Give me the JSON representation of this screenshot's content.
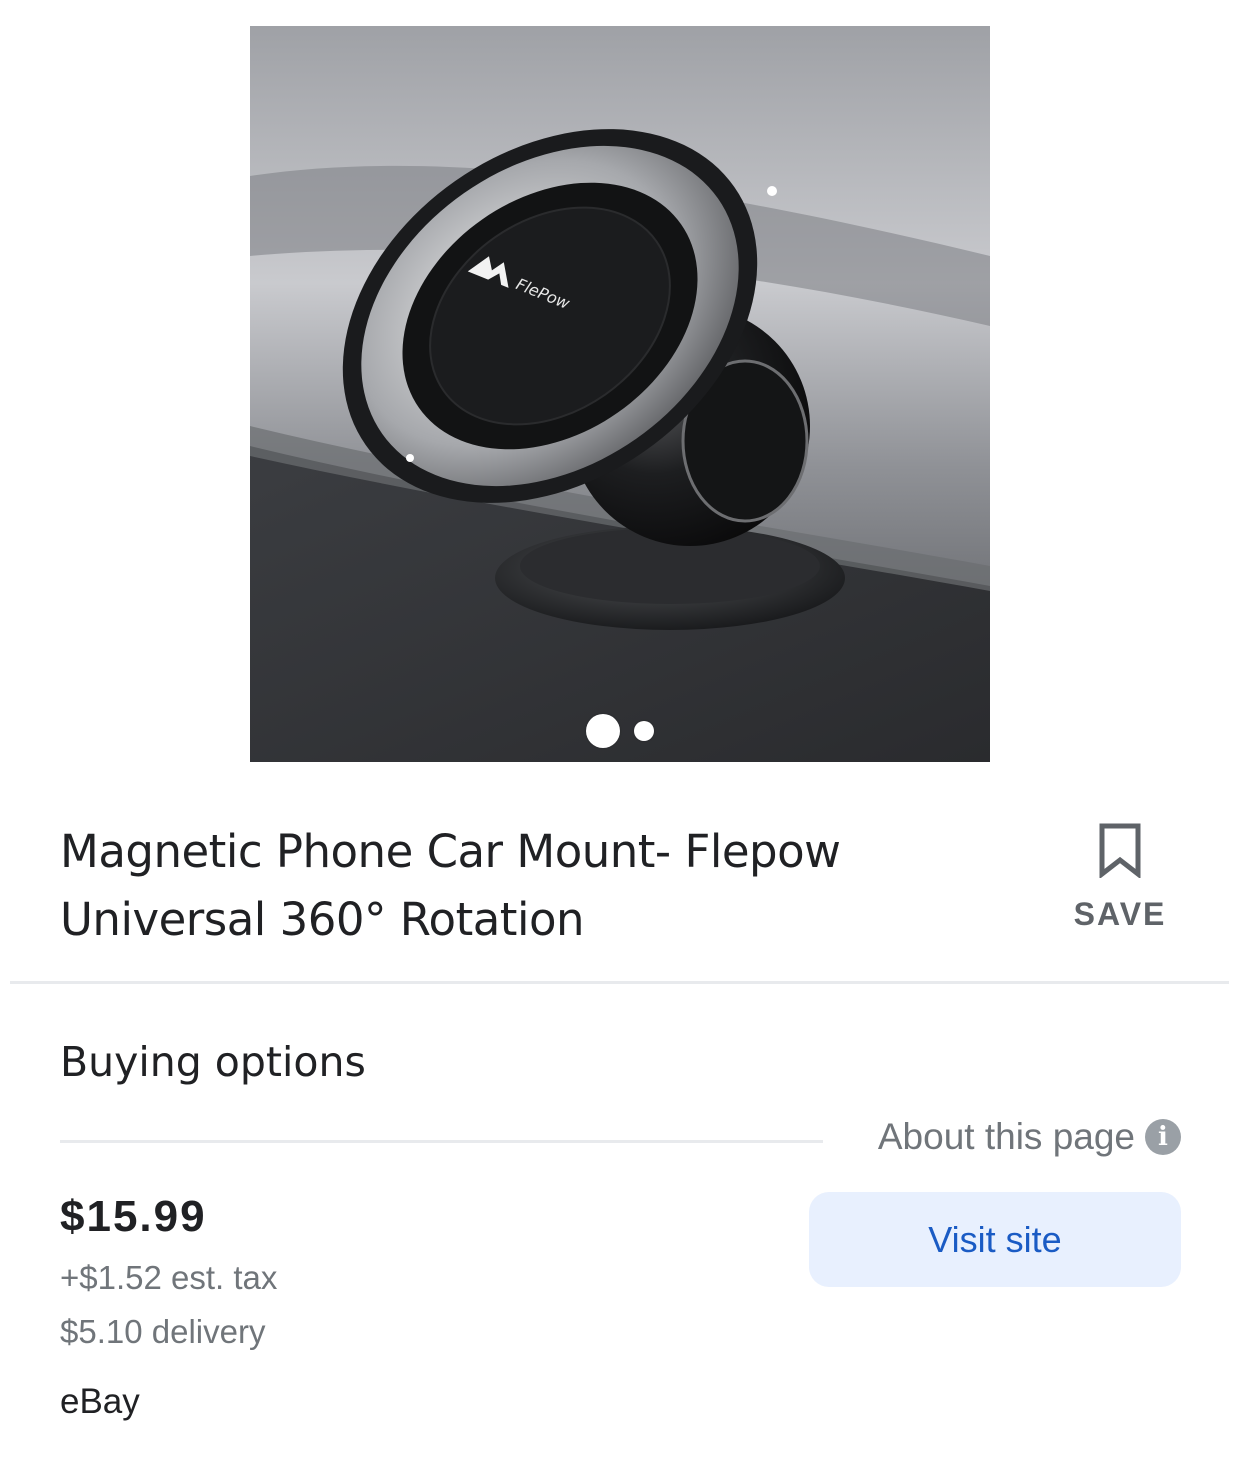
{
  "product": {
    "image": {
      "description_icon": "phone-car-mount-photo",
      "brand_mark": "FlePow",
      "carousel": {
        "total_images": 2,
        "active_index": 0
      }
    },
    "title": "Magnetic Phone Car Mount- Flepow Universal 360° Rotation",
    "save_label": "SAVE"
  },
  "buying_options": {
    "heading": "Buying options",
    "about_label": "About this page",
    "offer": {
      "price": "$15.99",
      "tax": "+$1.52 est. tax",
      "delivery": "$5.10 delivery",
      "merchant": "eBay",
      "visit_label": "Visit site"
    }
  },
  "colors": {
    "text_primary": "#202124",
    "text_secondary": "#70757a",
    "link_blue": "#1a5bc4",
    "button_bg": "#e8f0fe",
    "divider": "#e8eaed"
  }
}
